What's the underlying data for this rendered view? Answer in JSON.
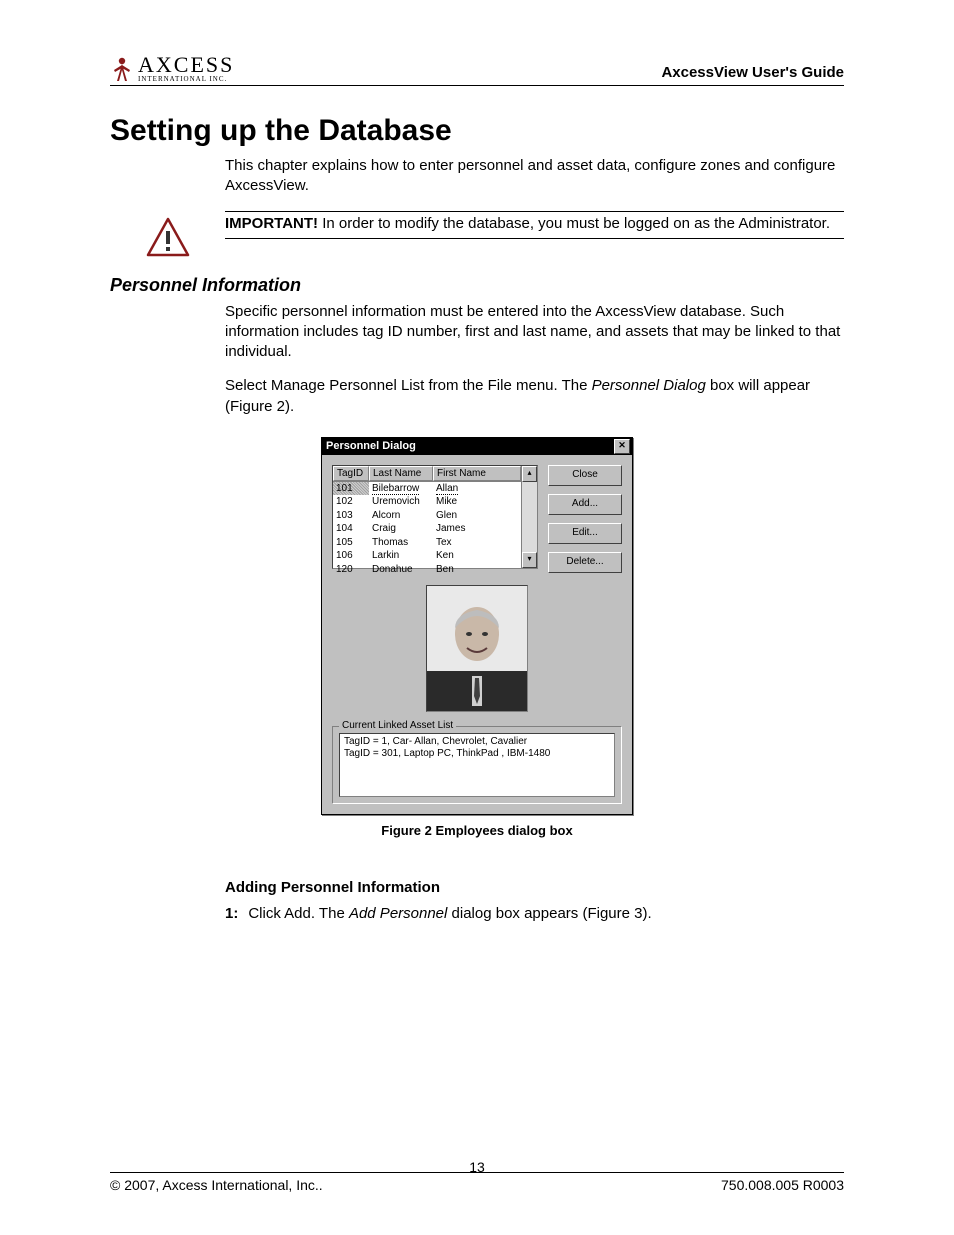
{
  "header": {
    "logo_top": "AXCESS",
    "logo_bot": "INTERNATIONAL INC.",
    "guide_title": "AxcessView User's Guide"
  },
  "chapter_title": "Setting up the Database",
  "intro_para": "This chapter explains how to enter personnel and asset data, configure zones and configure AxcessView.",
  "important_label": "IMPORTANT!",
  "important_text": "  In order to modify the database, you must be logged on as the Administrator.",
  "section_title": "Personnel Information",
  "para1": "Specific personnel information must be entered into the AxcessView database. Such information includes tag ID number, first and last name, and assets that may be linked to that individual.",
  "para2_a": "Select Manage Personnel List from the File menu. The ",
  "para2_italic": "Personnel Dialog",
  "para2_b": " box will appear (Figure 2).",
  "dialog": {
    "title": "Personnel Dialog",
    "columns": {
      "tagid": "TagID",
      "last": "Last Name",
      "first": "First Name"
    },
    "rows": [
      {
        "id": "101",
        "last": "Bilebarrow",
        "first": "Allan",
        "hl": true
      },
      {
        "id": "102",
        "last": "Uremovich",
        "first": "Mike"
      },
      {
        "id": "103",
        "last": "Alcorn",
        "first": "Glen"
      },
      {
        "id": "104",
        "last": "Craig",
        "first": "James"
      },
      {
        "id": "105",
        "last": "Thomas",
        "first": "Tex"
      },
      {
        "id": "106",
        "last": "Larkin",
        "first": "Ken"
      },
      {
        "id": "120",
        "last": "Donahue",
        "first": "Ben"
      }
    ],
    "buttons": {
      "close": "Close",
      "add": "Add...",
      "edit": "Edit...",
      "del": "Delete..."
    },
    "fieldset_label": "Current Linked Asset List",
    "assets": [
      "TagID = 1, Car- Allan, Chevrolet, Cavalier",
      "TagID = 301, Laptop PC, ThinkPad , IBM-1480"
    ]
  },
  "figure_caption": "Figure 2 Employees dialog box",
  "sub_heading": "Adding Personnel Information",
  "step1_num": "1:",
  "step1_a": "Click Add. The ",
  "step1_italic": "Add Personnel",
  "step1_b": " dialog box appears (Figure 3).",
  "footer": {
    "left": "© 2007, Axcess International, Inc..",
    "center": "13",
    "right": "750.008.005 R0003"
  }
}
